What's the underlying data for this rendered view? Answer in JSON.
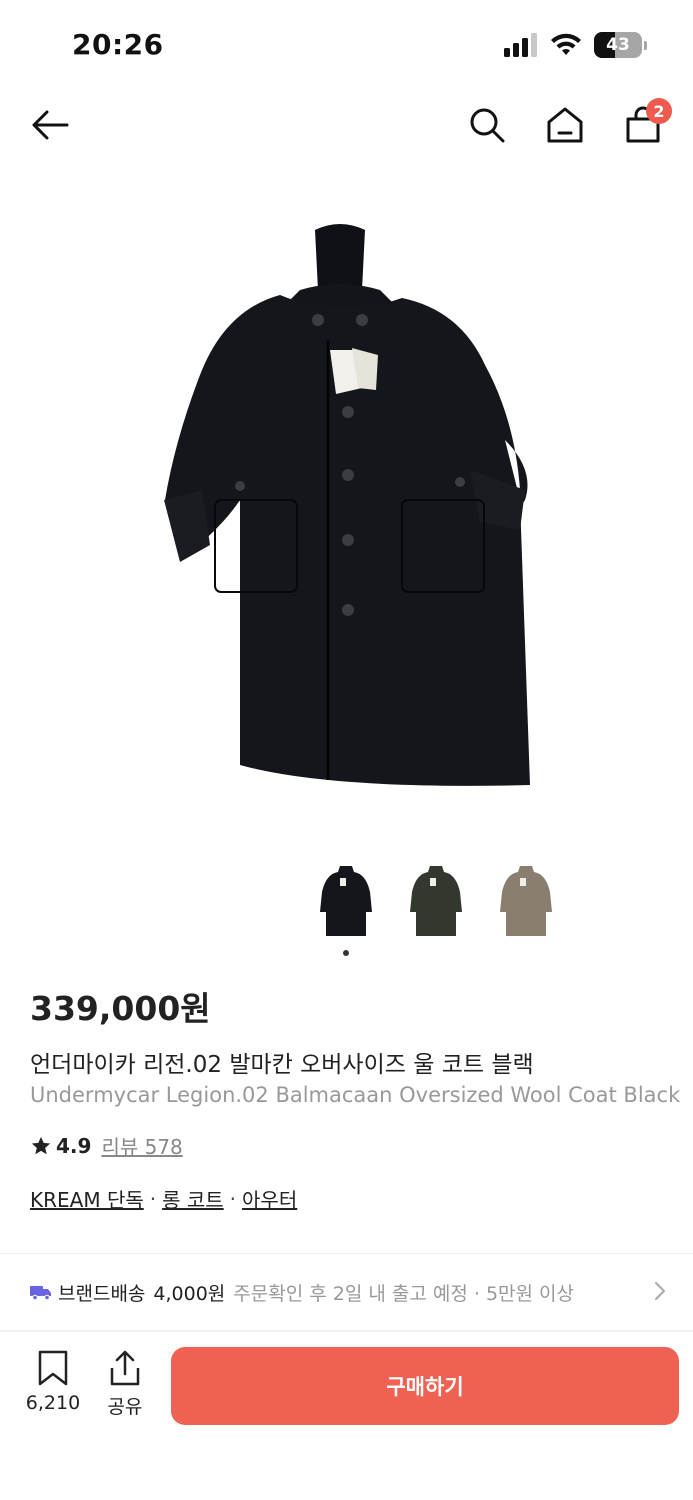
{
  "status_bar": {
    "time": "20:26",
    "battery": "43"
  },
  "nav": {
    "cart_count": "2"
  },
  "product": {
    "price": "339,000원",
    "title_ko": "언더마이카 리전.02 발마칸 오버사이즈 울 코트 블랙",
    "title_en": "Undermycar Legion.02 Balmacaan Oversized Wool Coat Black",
    "rating": "4.9",
    "review_label": "리뷰 578",
    "categories": [
      "KREAM 단독",
      "롱 코트",
      "아우터"
    ],
    "category_separator": "·",
    "thumbnail_colors": [
      "#15161b",
      "#33382f",
      "#8a7e70"
    ]
  },
  "shipping": {
    "brand_label": "브랜드배송",
    "fee": "4,000원",
    "detail": "주문확인 후 2일 내 출고 예정 · 5만원 이상"
  },
  "bottom_bar": {
    "bookmark_count": "6,210",
    "share_label": "공유",
    "buy_label": "구매하기"
  },
  "colors": {
    "accent": "#ef6253",
    "badge": "#ef5a4f",
    "truck_icon": "#6a63e0"
  }
}
